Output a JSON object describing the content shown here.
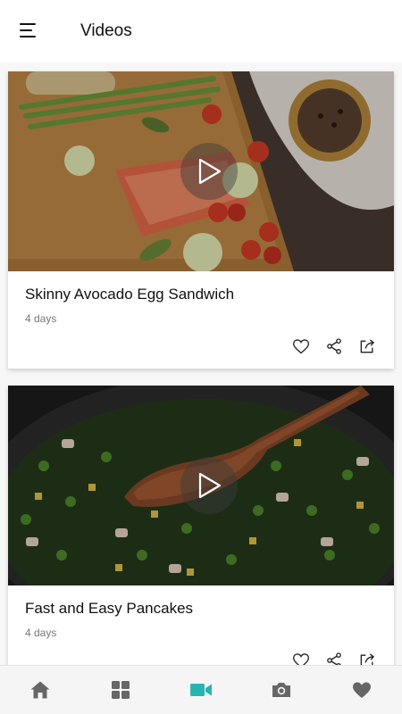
{
  "header": {
    "title": "Videos",
    "menu_icon": "hamburger-menu-icon"
  },
  "videos": [
    {
      "title": "Skinny Avocado Egg Sandwich",
      "age": "4 days",
      "thumbnail": "salmon-asparagus-board-image"
    },
    {
      "title": "Fast and Easy Pancakes",
      "age": "4 days",
      "thumbnail": "peas-spinach-skillet-image"
    }
  ],
  "card_actions": [
    "heart-icon",
    "share-icon",
    "export-icon"
  ],
  "tabbar": {
    "tabs": [
      "home-icon",
      "grid-icon",
      "video-camera-icon",
      "camera-icon",
      "heart-icon"
    ],
    "active_tab": "video-camera-icon",
    "active_color": "#26b5b0",
    "inactive_color": "#666666"
  }
}
